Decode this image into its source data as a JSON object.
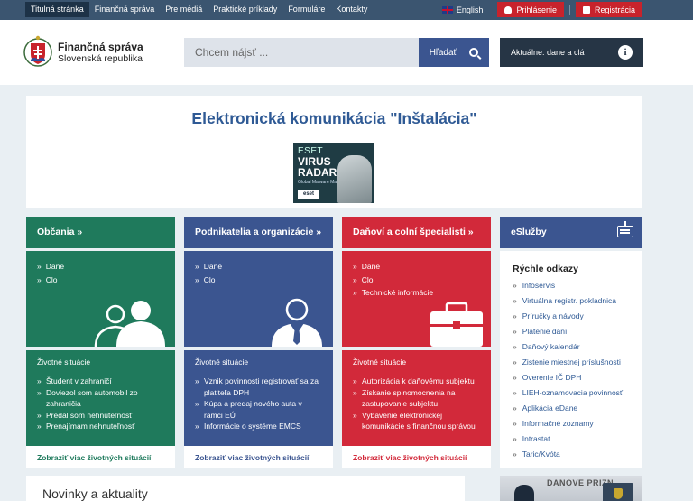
{
  "topnav": [
    "Titulná stránka",
    "Finančná správa",
    "Pre médiá",
    "Praktické príklady",
    "Formuláre",
    "Kontakty"
  ],
  "lang": "English",
  "login": "Prihlásenie",
  "register": "Registrácia",
  "logo": {
    "line1": "Finančná správa",
    "line2": "Slovenská republika"
  },
  "search": {
    "placeholder": "Chcem nájsť ...",
    "button": "Hľadať"
  },
  "aktualne": "Aktuálne: dane a clá",
  "banner": {
    "title": "Elektronická komunikácia \"Inštalácia\"",
    "ad": {
      "line1": "ESET",
      "line2": "VIRUS",
      "line3": "RADAR",
      "tagline": "Global Malware Map",
      "brand": "eset"
    }
  },
  "columns": [
    {
      "title": "Občania »",
      "links": [
        "Dane",
        "Clo"
      ],
      "situations_title": "Životné situácie",
      "situations": [
        "Študent v zahraničí",
        "Doviezol som automobil zo zahraničia",
        "Predal som nehnuteľnosť",
        "Prenajímam nehnuteľnosť"
      ],
      "more": "Zobraziť viac životných situácií"
    },
    {
      "title": "Podnikatelia a organizácie »",
      "links": [
        "Dane",
        "Clo"
      ],
      "situations_title": "Životné situácie",
      "situations": [
        "Vznik povinnosti registrovať sa za platiteľa DPH",
        "Kúpa a predaj nového auta v rámci EÚ",
        "Informácie o systéme EMCS"
      ],
      "more": "Zobraziť viac životných situácií"
    },
    {
      "title": "Daňoví a colní špecialisti »",
      "links": [
        "Dane",
        "Clo",
        "Technické informácie"
      ],
      "situations_title": "Životné situácie",
      "situations": [
        "Autorizácia k daňovému subjektu",
        "Získanie splnomocnenia na zastupovanie subjektu",
        "Vybavenie elektronickej komunikácie s finančnou správou"
      ],
      "more": "Zobraziť viac životných situácií"
    }
  ],
  "esluzby": {
    "title": "eSlužby",
    "quick_title": "Rýchle odkazy",
    "links": [
      "Infoservis",
      "Virtuálna registr. pokladnica",
      "Príručky a návody",
      "Platenie daní",
      "Daňový kalendár",
      "Zistenie miestnej príslušnosti",
      "Overenie IČ DPH",
      "LIEH-oznamovacia povinnosť",
      "Aplikácia eDane",
      "Informačné zoznamy",
      "Intrastat",
      "Taric/Kvóta"
    ]
  },
  "news": {
    "title": "Novinky a aktuality",
    "image_text": "DANOVE PRIZN"
  }
}
